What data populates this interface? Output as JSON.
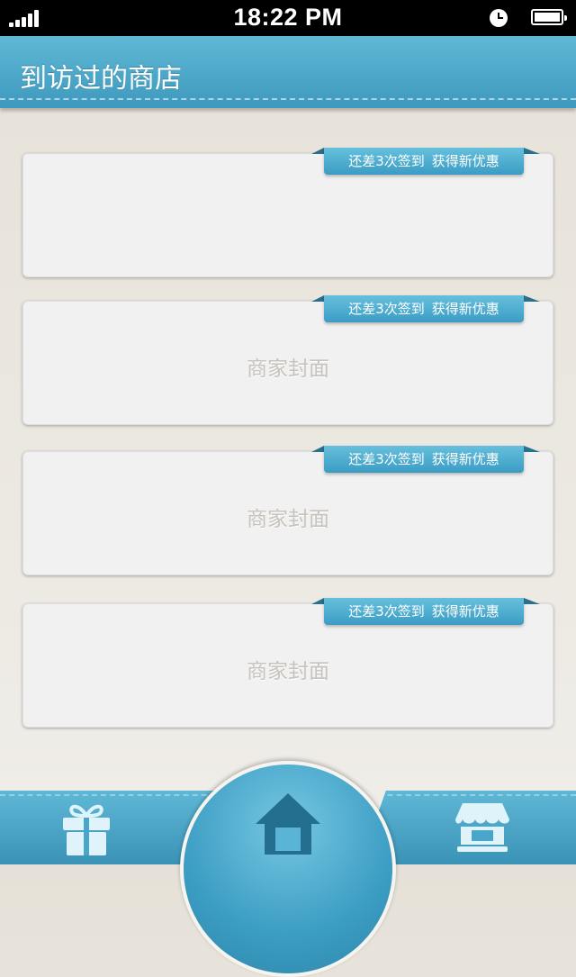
{
  "status_bar": {
    "time": "18:22 PM",
    "signal_icon": "signal-bars-icon",
    "clock_icon": "clock-icon",
    "battery_icon": "battery-icon"
  },
  "header": {
    "title": "到访过的商店"
  },
  "stores": [
    {
      "ribbon": {
        "part1": "还差3次签到",
        "part2": "获得新优惠"
      },
      "cover": ""
    },
    {
      "ribbon": {
        "part1": "还差3次签到",
        "part2": "获得新优惠"
      },
      "cover": "商家封面"
    },
    {
      "ribbon": {
        "part1": "还差3次签到",
        "part2": "获得新优惠"
      },
      "cover": "商家封面"
    },
    {
      "ribbon": {
        "part1": "还差3次签到",
        "part2": "获得新优惠"
      },
      "cover": "商家封面"
    }
  ],
  "bottom_nav": {
    "left_icon": "gift-icon",
    "center_icon": "home-icon",
    "right_icon": "store-icon"
  },
  "colors": {
    "accent": "#4aaacb",
    "header_top": "#5fb8d6",
    "header_bottom": "#3e99bd",
    "card_bg": "#f1f1f1",
    "cover_text": "#c7c3bc"
  }
}
